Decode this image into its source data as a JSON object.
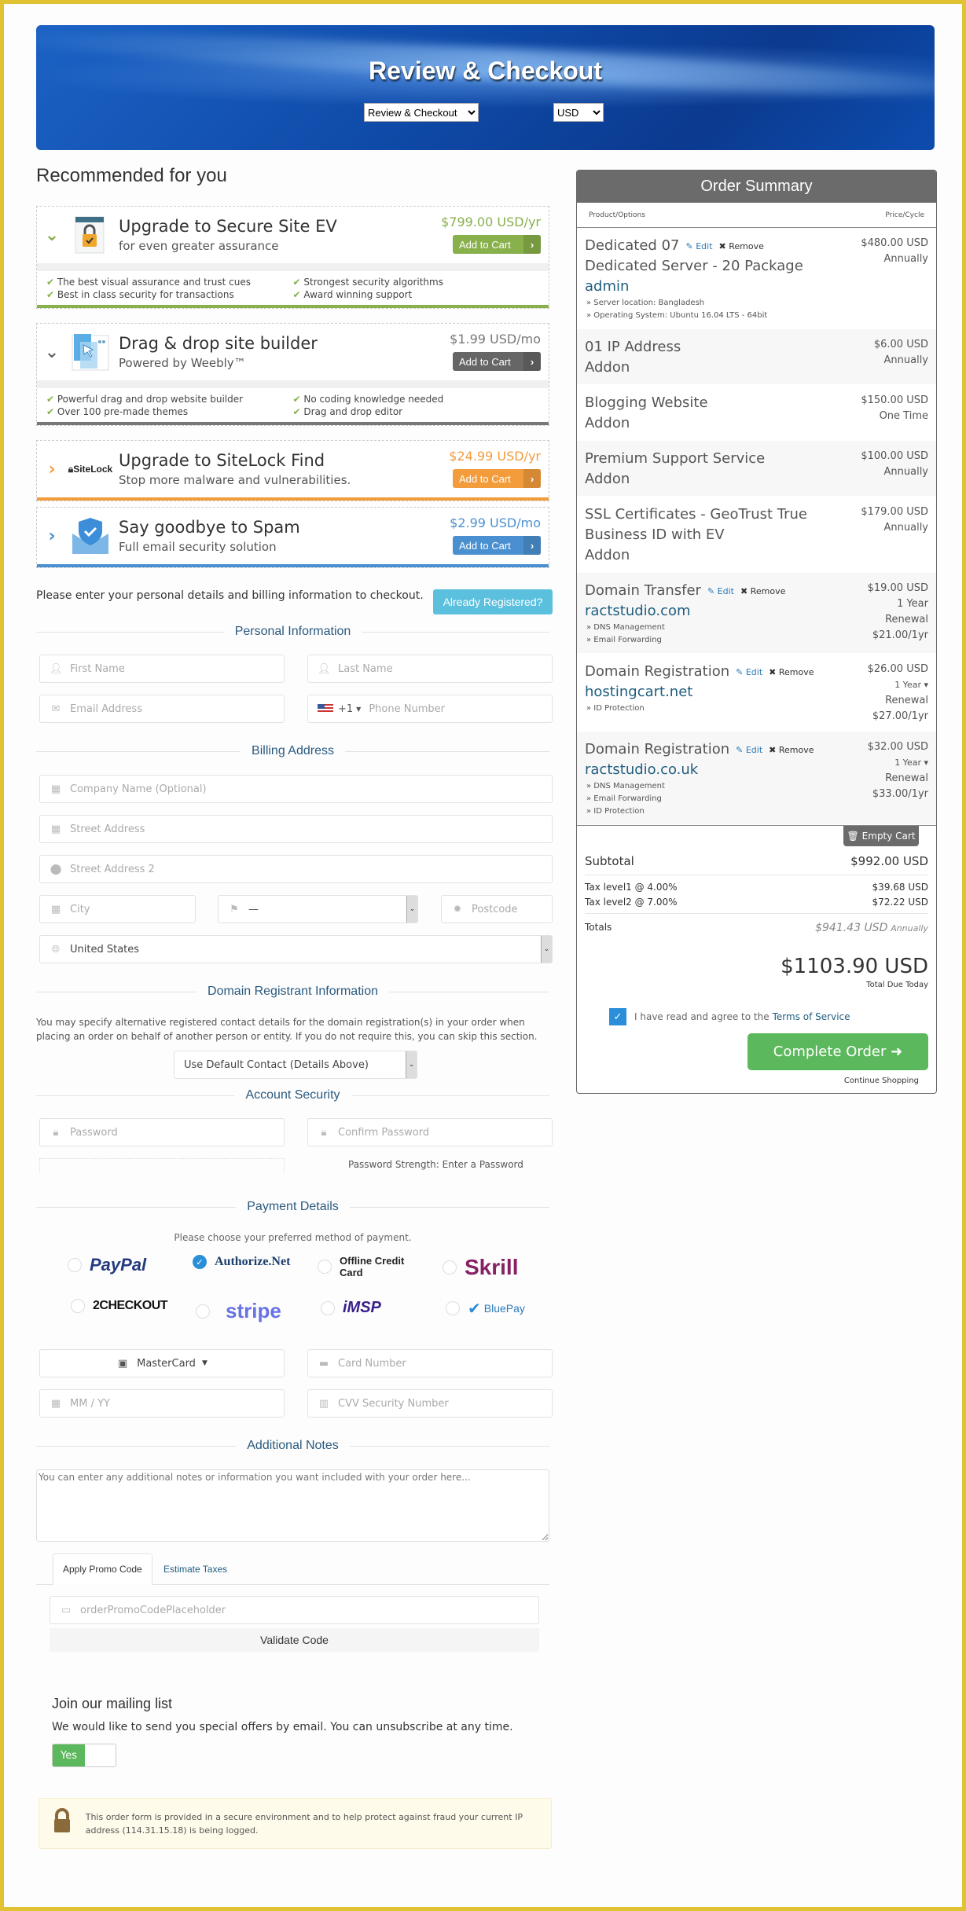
{
  "header": {
    "title": "Review & Checkout",
    "step_select": "Review & Checkout",
    "currency_select": "USD"
  },
  "recommended": {
    "title": "Recommended for you",
    "items": [
      {
        "title": "Upgrade to Secure Site EV",
        "subtitle": "for even greater assurance",
        "price": "$799.00 USD/yr",
        "button": "Add to Cart",
        "color": "#88b04b",
        "features": [
          "The best visual assurance and trust cues",
          "Strongest security algorithms",
          "Best in class security for transactions",
          "Award winning support"
        ]
      },
      {
        "title": "Drag & drop site builder",
        "subtitle": "Powered by Weebly™",
        "price": "$1.99 USD/mo",
        "button": "Add to Cart",
        "color": "#666666",
        "features": [
          "Powerful drag and drop website builder",
          "No coding knowledge needed",
          "Over 100 pre-made themes",
          "Drag and drop editor"
        ]
      },
      {
        "title": "Upgrade to SiteLock Find",
        "subtitle": "Stop more malware and vulnerabilities.",
        "price": "$24.99 USD/yr",
        "button": "Add to Cart",
        "color": "#f39c3c",
        "logo": "SiteLock"
      },
      {
        "title": "Say goodbye to Spam",
        "subtitle": "Full email security solution",
        "price": "$2.99 USD/mo",
        "button": "Add to Cart",
        "color": "#4a90d0"
      }
    ]
  },
  "checkout": {
    "intro": "Please enter your personal details and billing information to checkout.",
    "already_registered": "Already Registered?",
    "personal_title": "Personal Information",
    "first_name": "First Name",
    "last_name": "Last Name",
    "email": "Email Address",
    "phone_code": "+1",
    "phone": "Phone Number",
    "billing_title": "Billing Address",
    "company": "Company Name (Optional)",
    "street": "Street Address",
    "street2": "Street Address 2",
    "city": "City",
    "state": "—",
    "postcode": "Postcode",
    "country": "United States",
    "domain_title": "Domain Registrant Information",
    "domain_note": "You may specify alternative registered contact details for the domain registration(s) in your order when placing an order on behalf of another person or entity. If you do not require this, you can skip this section.",
    "domain_contact": "Use Default Contact (Details Above)",
    "security_title": "Account Security",
    "password": "Password",
    "confirm_password": "Confirm Password",
    "password_strength": "Password Strength: Enter a Password",
    "payment_title": "Payment Details",
    "payment_sub": "Please choose your preferred method of payment.",
    "payment_methods": [
      {
        "name": "PayPal",
        "selected": false
      },
      {
        "name": "Authorize.Net",
        "selected": true
      },
      {
        "name": "Offline Credit Card",
        "selected": false
      },
      {
        "name": "Skrill",
        "selected": false
      },
      {
        "name": "2CHECKOUT",
        "selected": false
      },
      {
        "name": "stripe",
        "selected": false
      },
      {
        "name": "iMSP",
        "selected": false
      },
      {
        "name": "BluePay",
        "selected": false
      }
    ],
    "card_type": "MasterCard",
    "card_number": "Card Number",
    "expiry": "MM / YY",
    "cvv": "CVV Security Number",
    "notes_title": "Additional Notes",
    "notes_placeholder": "You can enter any additional notes or information you want included with your order here...",
    "tab_promo": "Apply Promo Code",
    "tab_taxes": "Estimate Taxes",
    "promo_placeholder": "orderPromoCodePlaceholder",
    "validate": "Validate Code",
    "mailing_title": "Join our mailing list",
    "mailing_text": "We would like to send you special offers by email. You can unsubscribe at any time.",
    "mailing_toggle": "Yes",
    "secure_text": "This order form is provided in a secure environment and to help protect against fraud your current IP address (114.31.15.18) is being logged."
  },
  "summary": {
    "title": "Order Summary",
    "col_product": "Product/Options",
    "col_price": "Price/Cycle",
    "edit": "Edit",
    "remove": "Remove",
    "items": [
      {
        "name": "Dedicated 07",
        "group": "Dedicated Server - 20 Package",
        "domain": "admin",
        "options": [
          "» Server location: Bangladesh",
          "» Operating System: Ubuntu 16.04 LTS - 64bit"
        ],
        "price": "$480.00 USD",
        "cycle": "Annually"
      },
      {
        "name": "01 IP Address",
        "group": "Addon",
        "price": "$6.00 USD",
        "cycle": "Annually"
      },
      {
        "name": "Blogging Website",
        "group": "Addon",
        "price": "$150.00 USD",
        "cycle": "One Time"
      },
      {
        "name": "Premium Support Service",
        "group": "Addon",
        "price": "$100.00 USD",
        "cycle": "Annually"
      },
      {
        "name": "SSL Certificates - GeoTrust True Business ID with EV",
        "group": "Addon",
        "price": "$179.00 USD",
        "cycle": "Annually"
      },
      {
        "name": "Domain Transfer",
        "domain": "ractstudio.com",
        "options": [
          "» DNS Management",
          "» Email Forwarding"
        ],
        "price": "$19.00 USD",
        "cycle": "1 Year",
        "renewal_label": "Renewal",
        "renewal": "$21.00/1yr"
      },
      {
        "name": "Domain Registration",
        "domain": "hostingcart.net",
        "options": [
          "» ID Protection"
        ],
        "price": "$26.00 USD",
        "cycle": "1 Year ▾",
        "renewal_label": "Renewal",
        "renewal": "$27.00/1yr"
      },
      {
        "name": "Domain Registration",
        "domain": "ractstudio.co.uk",
        "options": [
          "» DNS Management",
          "» Email Forwarding",
          "» ID Protection"
        ],
        "price": "$32.00 USD",
        "cycle": "1 Year ▾",
        "renewal_label": "Renewal",
        "renewal": "$33.00/1yr"
      }
    ],
    "empty_cart": "Empty Cart",
    "subtotal_label": "Subtotal",
    "subtotal": "$992.00 USD",
    "tax1_label": "Tax level1 @ 4.00%",
    "tax1": "$39.68 USD",
    "tax2_label": "Tax level2 @ 7.00%",
    "tax2": "$72.22 USD",
    "totals_label": "Totals",
    "totals": "$941.43 USD",
    "totals_cycle": "Annually",
    "total_due": "$1103.90 USD",
    "total_due_label": "Total Due Today",
    "tos_text": "I have read and agree to the",
    "tos_link": "Terms of Service",
    "complete": "Complete Order",
    "continue": "Continue Shopping"
  }
}
